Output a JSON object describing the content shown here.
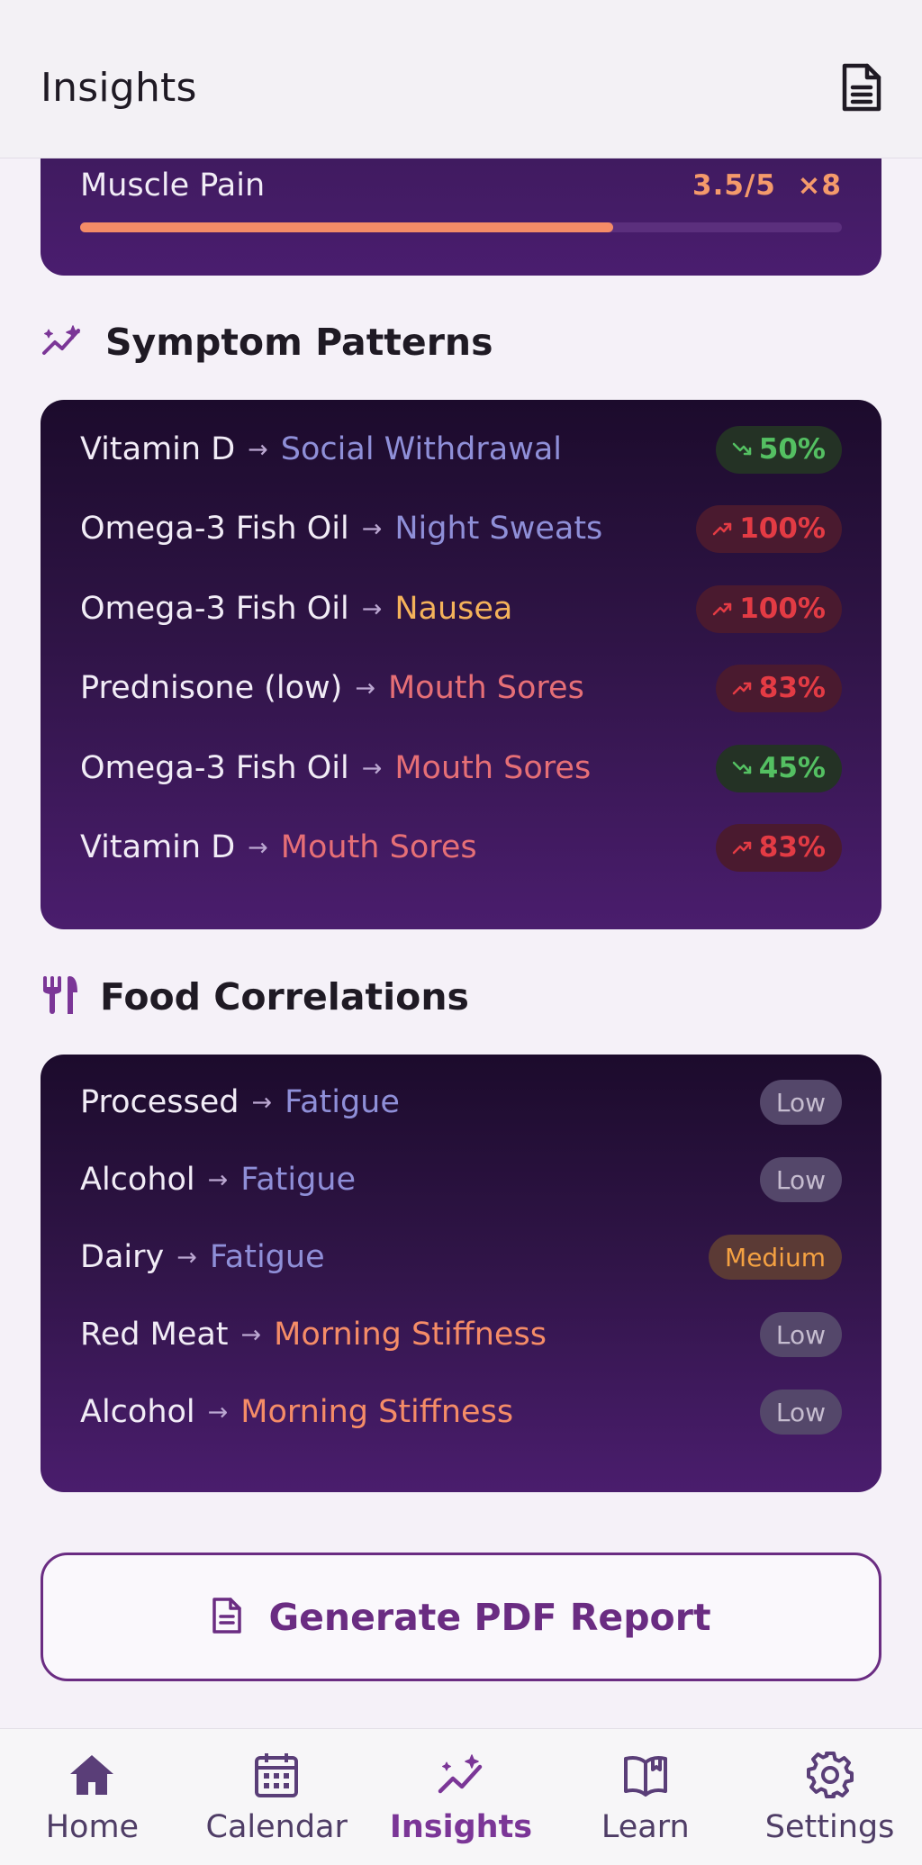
{
  "header": {
    "title": "Insights",
    "report_icon": "document-icon"
  },
  "top_metric": {
    "name": "Muscle Pain",
    "score_label": "3.5/5",
    "count_label": "×8",
    "fill_fraction": 0.7
  },
  "symptom_patterns": {
    "title": "Symptom Patterns",
    "icon": "sparkle-trend-icon",
    "rows": [
      {
        "source": "Vitamin D",
        "target": "Social Withdrawal",
        "target_color": "#8f8fd8",
        "trend": "down",
        "value": "50%"
      },
      {
        "source": "Omega-3 Fish Oil",
        "target": "Night Sweats",
        "target_color": "#8f8fd8",
        "trend": "up",
        "value": "100%"
      },
      {
        "source": "Omega-3 Fish Oil",
        "target": "Nausea",
        "target_color": "#f4b25a",
        "trend": "up",
        "value": "100%"
      },
      {
        "source": "Prednisone (low)",
        "target": "Mouth Sores",
        "target_color": "#e66f76",
        "trend": "up",
        "value": "83%"
      },
      {
        "source": "Omega-3 Fish Oil",
        "target": "Mouth Sores",
        "target_color": "#e66f76",
        "trend": "down",
        "value": "45%"
      },
      {
        "source": "Vitamin D",
        "target": "Mouth Sores",
        "target_color": "#e66f76",
        "trend": "up",
        "value": "83%"
      }
    ]
  },
  "food_correlations": {
    "title": "Food Correlations",
    "icon": "utensils-icon",
    "rows": [
      {
        "source": "Processed",
        "target": "Fatigue",
        "target_color": "#8f8fd8",
        "level": "Low"
      },
      {
        "source": "Alcohol",
        "target": "Fatigue",
        "target_color": "#8f8fd8",
        "level": "Low"
      },
      {
        "source": "Dairy",
        "target": "Fatigue",
        "target_color": "#8f8fd8",
        "level": "Medium"
      },
      {
        "source": "Red Meat",
        "target": "Morning Stiffness",
        "target_color": "#f58c67",
        "level": "Low"
      },
      {
        "source": "Alcohol",
        "target": "Morning Stiffness",
        "target_color": "#f58c67",
        "level": "Low"
      }
    ]
  },
  "cta": {
    "label": "Generate PDF Report",
    "icon": "document-icon"
  },
  "bottom_nav": {
    "items": [
      {
        "label": "Home",
        "icon": "home-icon",
        "active": false
      },
      {
        "label": "Calendar",
        "icon": "calendar-icon",
        "active": false
      },
      {
        "label": "Insights",
        "icon": "insights-icon",
        "active": true
      },
      {
        "label": "Learn",
        "icon": "book-icon",
        "active": false
      },
      {
        "label": "Settings",
        "icon": "gear-icon",
        "active": false
      }
    ]
  },
  "colors": {
    "primary": "#7b3697",
    "green": "#54c062",
    "red": "#e33b44",
    "accent_orange": "#f58c67"
  }
}
